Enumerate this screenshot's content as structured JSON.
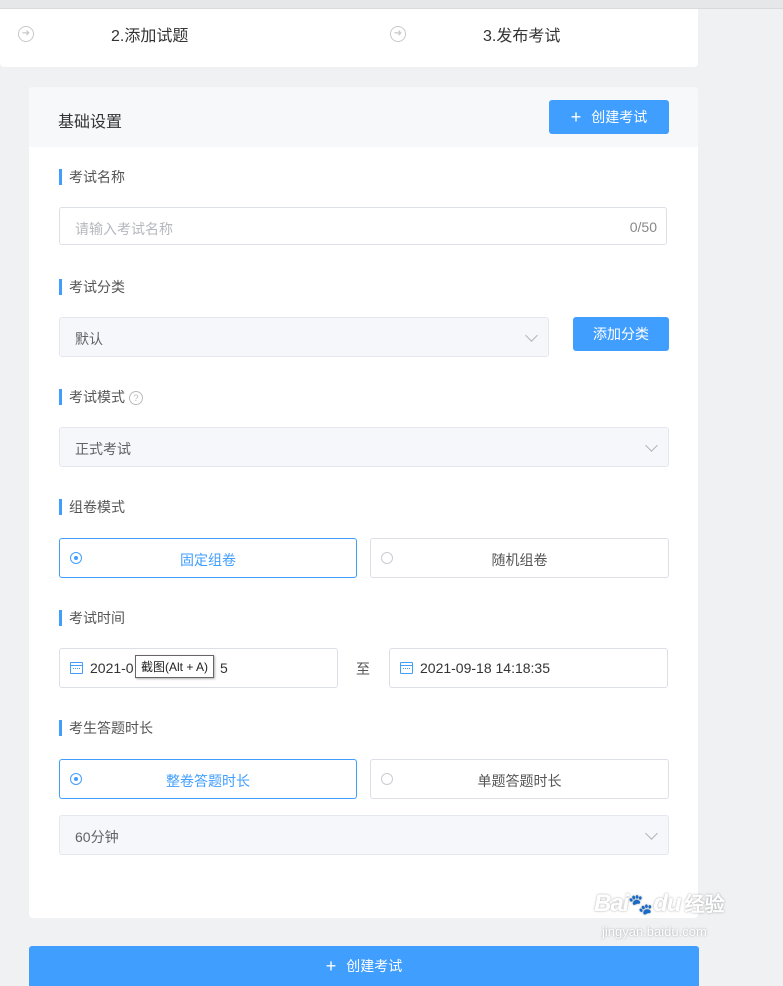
{
  "steps": [
    {
      "label": "2.添加试题",
      "icon": "arrow-right-circle-icon"
    },
    {
      "label": "3.发布考试",
      "icon": "arrow-right-circle-icon"
    }
  ],
  "card": {
    "title": "基础设置",
    "create_button": "创建考试"
  },
  "exam_name": {
    "label": "考试名称",
    "placeholder": "请输入考试名称",
    "count": "0/50"
  },
  "exam_category": {
    "label": "考试分类",
    "value": "默认",
    "add_button": "添加分类"
  },
  "exam_mode": {
    "label": "考试模式",
    "value": "正式考试"
  },
  "paper_mode": {
    "label": "组卷模式",
    "options": [
      "固定组卷",
      "随机组卷"
    ],
    "selected": "固定组卷"
  },
  "exam_time": {
    "label": "考试时间",
    "start": "2021-0",
    "start_tail": "5",
    "separator": "至",
    "end": "2021-09-18 14:18:35"
  },
  "tooltip": "截图(Alt + A)",
  "answer_duration": {
    "label": "考生答题时长",
    "options": [
      "整卷答题时长",
      "单题答题时长"
    ],
    "selected": "整卷答题时长",
    "value": "60分钟"
  },
  "bottom_button": "创建考试",
  "watermark": {
    "brand": "Bai",
    "brand_tail": "du",
    "zh": "经验",
    "url": "jingyan.baidu.com"
  },
  "colors": {
    "primary": "#409eff",
    "background": "#f0f1f3"
  }
}
